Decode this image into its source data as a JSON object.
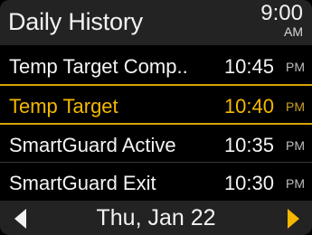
{
  "header": {
    "title": "Daily History",
    "time": "9:00",
    "ampm": "AM"
  },
  "rows": [
    {
      "label": "Temp Target Comp..",
      "time": "10:45",
      "ampm": "PM",
      "selected": false
    },
    {
      "label": "Temp Target",
      "time": "10:40",
      "ampm": "PM",
      "selected": true
    },
    {
      "label": "SmartGuard Active",
      "time": "10:35",
      "ampm": "PM",
      "selected": false
    },
    {
      "label": "SmartGuard Exit",
      "time": "10:30",
      "ampm": "PM",
      "selected": false
    }
  ],
  "footer": {
    "date": "Thu, Jan 22"
  },
  "colors": {
    "accent": "#f5b800",
    "background": "#000000",
    "bar": "#232323"
  },
  "icons": {
    "prev": "left-arrow-icon",
    "next": "right-arrow-icon"
  }
}
